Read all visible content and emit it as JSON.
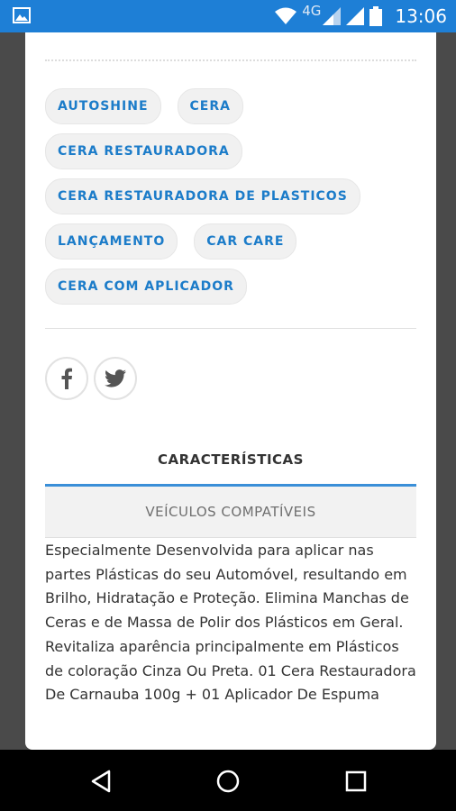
{
  "status_bar": {
    "network": "4G",
    "time": "13:06",
    "icons": [
      "image-icon",
      "wifi-icon",
      "signal-icon",
      "signal-icon",
      "battery-icon"
    ]
  },
  "tags": [
    "AUTOSHINE",
    "CERA",
    "CERA RESTAURADORA",
    "CERA RESTAURADORA DE PLASTICOS",
    "LANÇAMENTO",
    "CAR CARE",
    "CERA COM APLICADOR"
  ],
  "social": [
    "facebook-icon",
    "twitter-icon"
  ],
  "section_title": "CARACTERÍSTICAS",
  "tab_label": "VEÍCULOS COMPATÍVEIS",
  "description": "Especialmente Desenvolvida para aplicar nas partes Plásticas do seu Automóvel, resultando em Brilho, Hidratação e Proteção. Elimina Manchas de Ceras e de Massa de Polir dos Plásticos em Geral. Revitaliza aparência principalmente em Plásticos de coloração Cinza Ou Preta. 01 Cera Restauradora De Carnauba 100g + 01 Aplicador De Espuma",
  "colors": {
    "status_bar": "#1e7fd6",
    "tag_text": "#1c7cc9",
    "tab_accent": "#3a8fd8"
  },
  "nav": [
    "back-icon",
    "home-icon",
    "recents-icon"
  ]
}
